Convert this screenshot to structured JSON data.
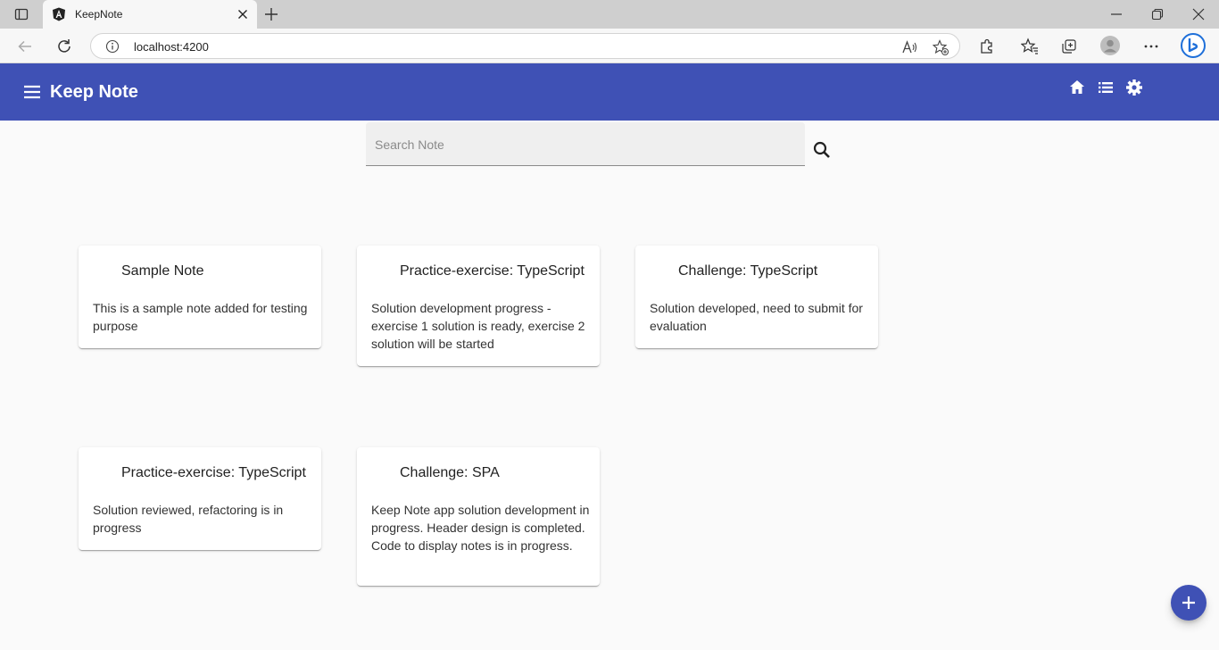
{
  "browser": {
    "tab_title": "KeepNote",
    "url": "localhost:4200"
  },
  "app": {
    "title": "Keep Note",
    "brand_color": "#3f51b5",
    "header_icons": [
      "home-icon",
      "list-icon",
      "settings-icon"
    ]
  },
  "search": {
    "placeholder": "Search Note",
    "value": ""
  },
  "notes": [
    {
      "title": "Sample Note",
      "text": "This is a sample note added for testing purpose"
    },
    {
      "title": "Practice-exercise: TypeScript",
      "text": "Solution development progress - exercise 1 solution is ready, exercise 2 solution will be started"
    },
    {
      "title": "Challenge: TypeScript",
      "text": "Solution developed, need to submit for evaluation"
    },
    {
      "title": "Practice-exercise: TypeScript",
      "text": "Solution reviewed, refactoring is in progress"
    },
    {
      "title": "Challenge: SPA",
      "text": "Keep Note app solution development in progress. Header design is completed. Code to display notes is in progress."
    }
  ]
}
